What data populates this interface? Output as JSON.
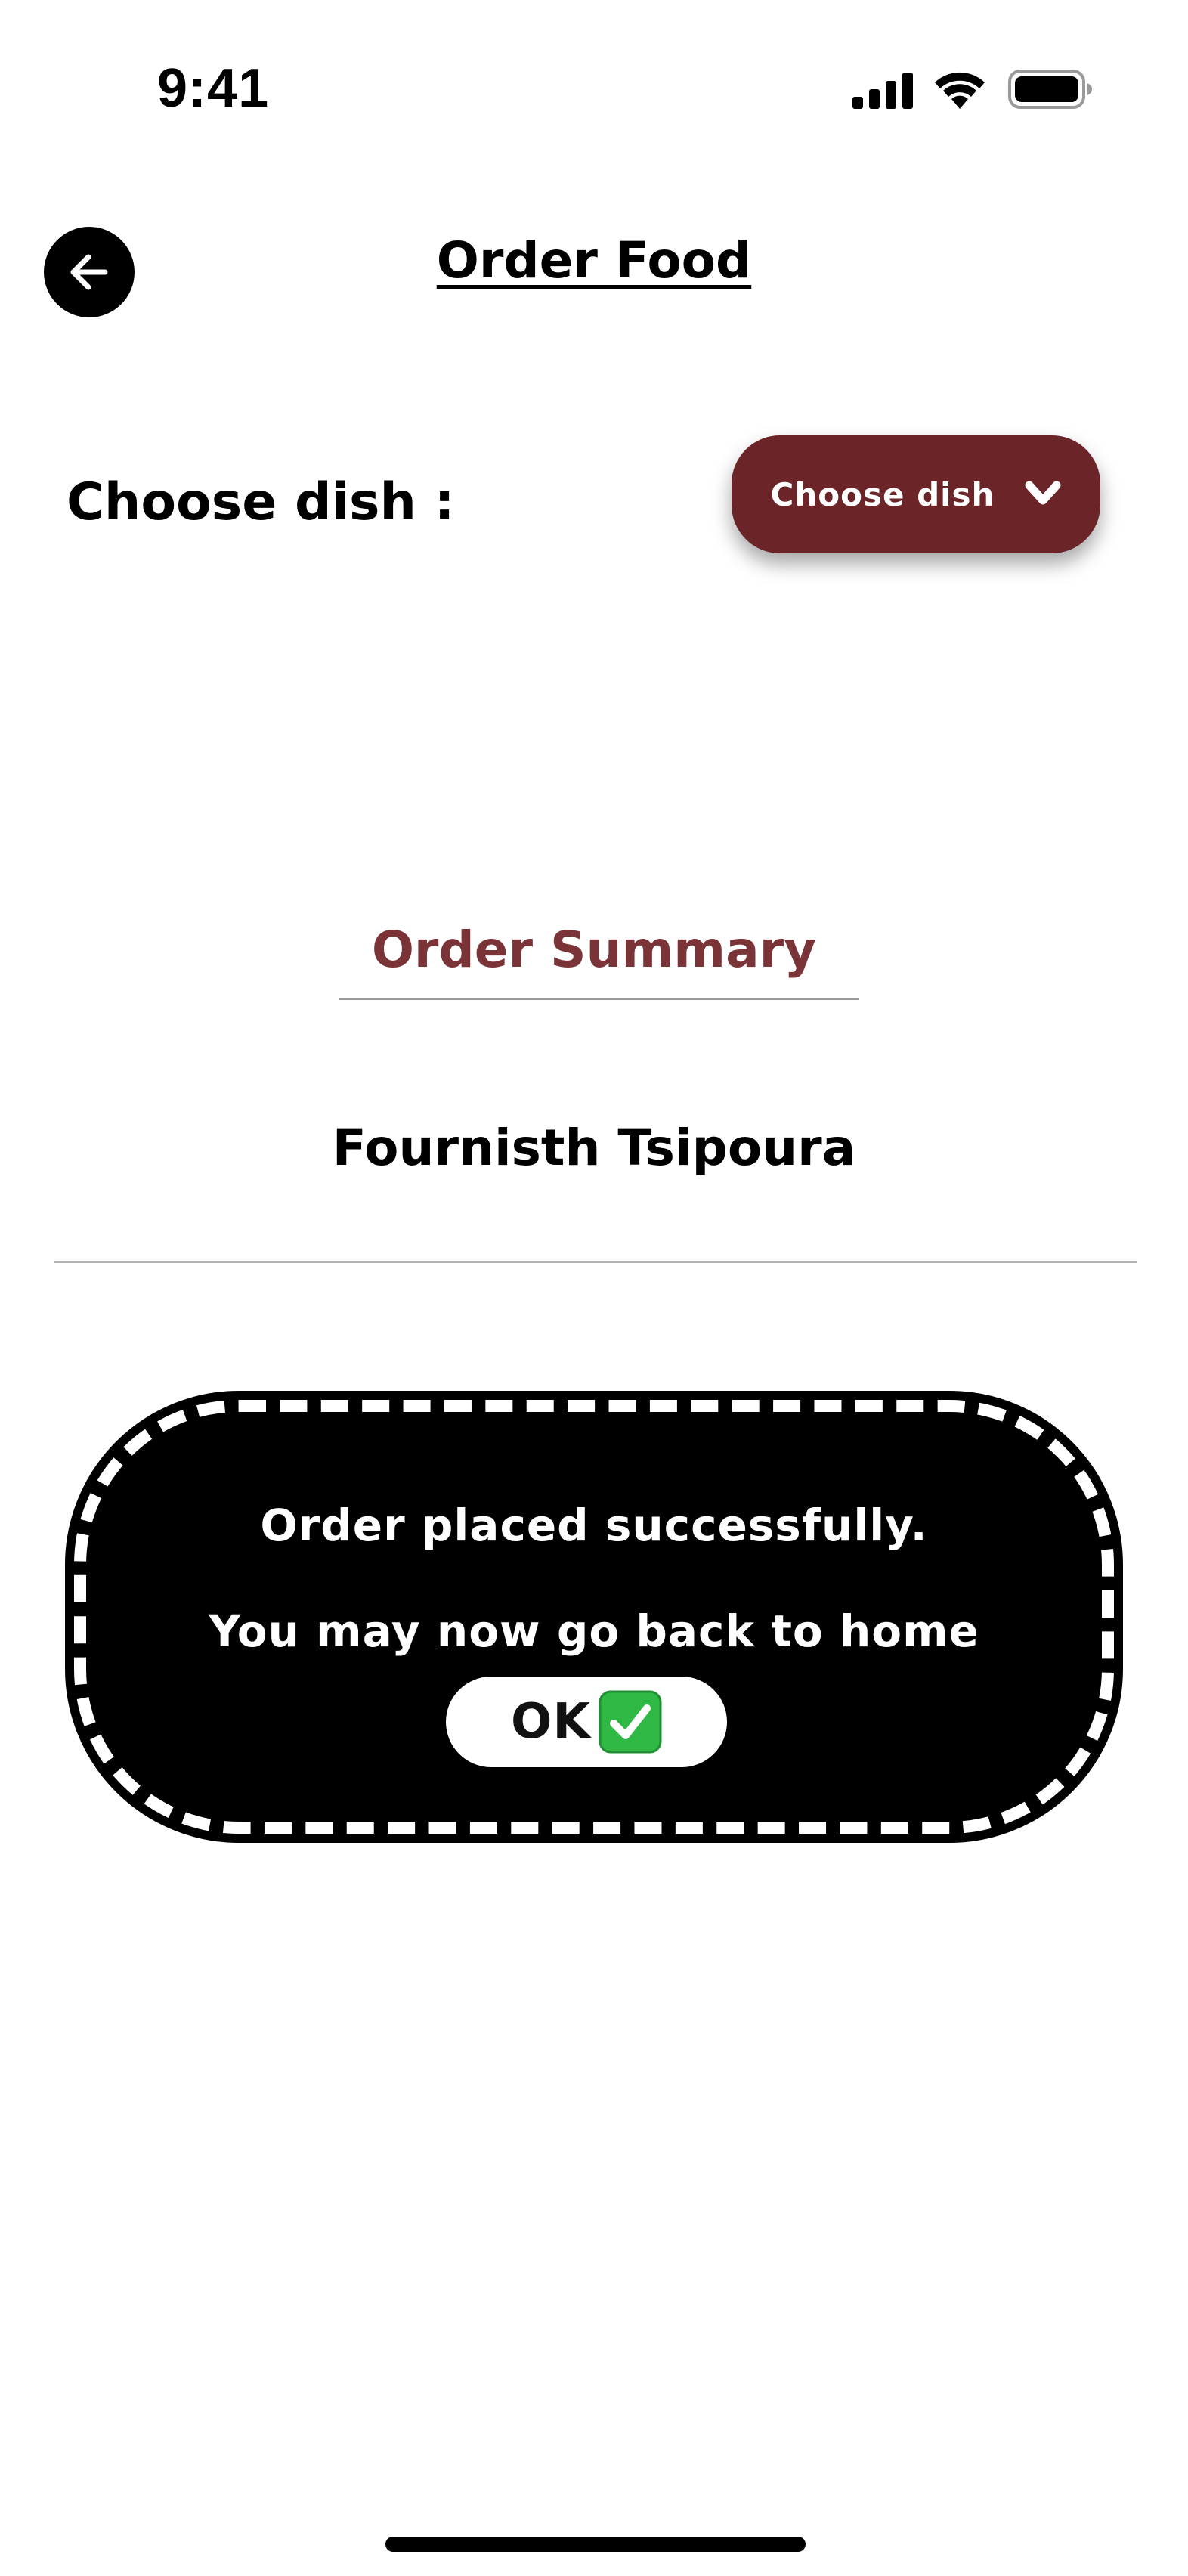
{
  "status_bar": {
    "time": "9:41",
    "icons": [
      "signal-icon",
      "wifi-icon",
      "battery-icon"
    ]
  },
  "header": {
    "back_icon": "arrow-left-icon",
    "title": "Order Food"
  },
  "dish_selector": {
    "label": "Choose dish :",
    "dropdown_label": "Choose dish",
    "dropdown_icon": "chevron-down-icon"
  },
  "summary": {
    "heading": "Order Summary",
    "dish_name": "Fournisth Tsipoura"
  },
  "dialog": {
    "line1": "Order placed successfully.",
    "line2": "You may now go back to home",
    "ok_label": "OK",
    "ok_icon": "check-mark-icon"
  },
  "colors": {
    "accent": "#6b2529",
    "summary_heading": "#7a3438",
    "dialog_background": "#000000",
    "check_green": "#2fb944"
  }
}
